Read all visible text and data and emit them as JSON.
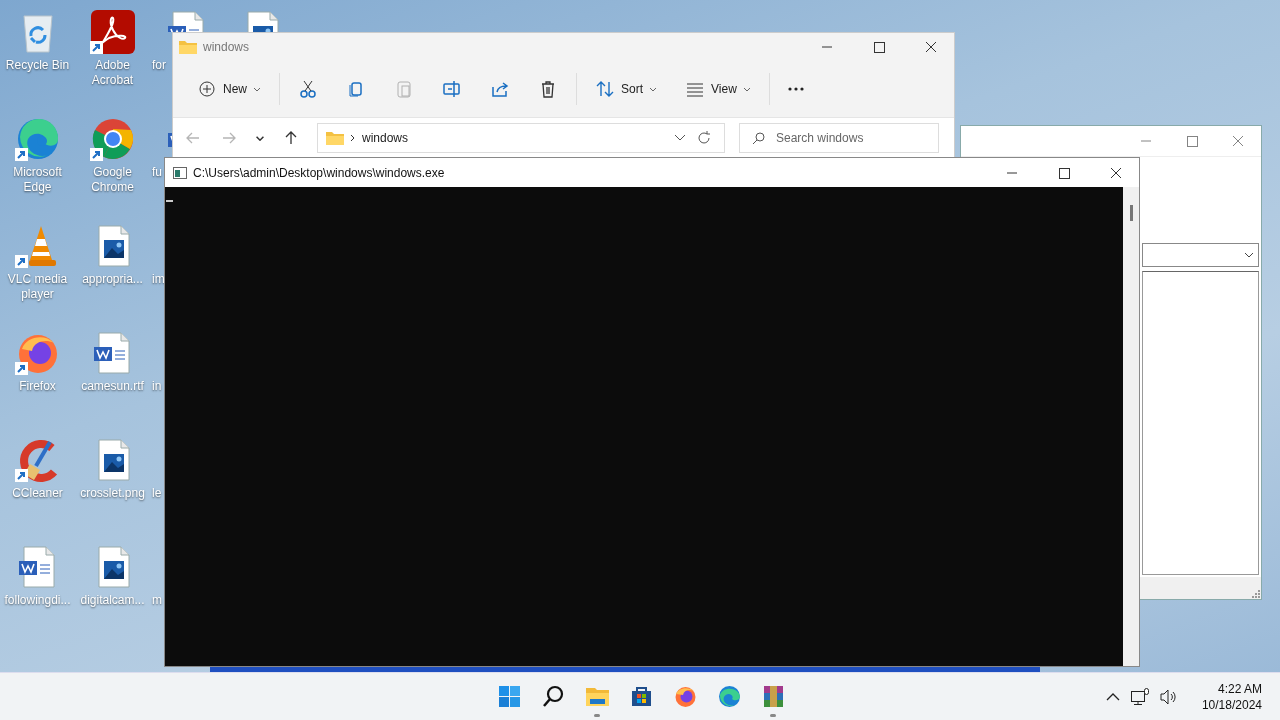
{
  "desktop_icons": [
    {
      "kind": "recycle",
      "label": "Recycle Bin"
    },
    {
      "kind": "edge",
      "label": "Microsoft Edge",
      "shortcut": true
    },
    {
      "kind": "vlc",
      "label": "VLC media player",
      "shortcut": true
    },
    {
      "kind": "firefox",
      "label": "Firefox",
      "shortcut": true
    },
    {
      "kind": "ccleaner",
      "label": "CCleaner",
      "shortcut": true
    },
    {
      "kind": "word",
      "label": "followingdi..."
    },
    {
      "kind": "acrobat",
      "label": "Adobe Acrobat",
      "shortcut": true
    },
    {
      "kind": "chrome",
      "label": "Google Chrome",
      "shortcut": true
    },
    {
      "kind": "image",
      "label": "appropria..."
    },
    {
      "kind": "word",
      "label": "camesun.rtf"
    },
    {
      "kind": "image",
      "label": "crosslet.png"
    },
    {
      "kind": "image",
      "label": "digitalcam..."
    },
    {
      "kind": "word",
      "label": "for"
    },
    {
      "kind": "word",
      "label": "fu"
    },
    {
      "kind": "none",
      "label": "im"
    },
    {
      "kind": "none",
      "label": "in"
    },
    {
      "kind": "none",
      "label": "le"
    },
    {
      "kind": "none",
      "label": "m"
    },
    {
      "kind": "image"
    }
  ],
  "explorer": {
    "title": "windows",
    "toolbar": [
      {
        "kind": "new",
        "label": "New",
        "disabled": false
      },
      {
        "kind": "cut",
        "disabled": false
      },
      {
        "kind": "copy",
        "disabled": false
      },
      {
        "kind": "paste",
        "disabled": true
      },
      {
        "kind": "rename",
        "disabled": false
      },
      {
        "kind": "share",
        "disabled": false
      },
      {
        "kind": "delete",
        "disabled": false
      },
      {
        "kind": "sort",
        "label": "Sort",
        "disabled": false
      },
      {
        "kind": "view",
        "label": "View",
        "disabled": false
      },
      {
        "kind": "more",
        "disabled": false
      }
    ],
    "nav": [
      {
        "kind": "back",
        "disabled": true
      },
      {
        "kind": "forward",
        "disabled": true
      },
      {
        "kind": "recent",
        "disabled": false
      },
      {
        "kind": "up",
        "disabled": false
      }
    ],
    "breadcrumb": "windows",
    "search": {
      "placeholder": "Search windows"
    }
  },
  "console": {
    "title": "C:\\Users\\admin\\Desktop\\windows\\windows.exe"
  },
  "taskbar": {
    "apps": [
      {
        "kind": "start",
        "running": false
      },
      {
        "kind": "search",
        "running": false
      },
      {
        "kind": "explorer",
        "running": true
      },
      {
        "kind": "store",
        "running": false
      },
      {
        "kind": "firefox",
        "running": false
      },
      {
        "kind": "edge",
        "running": false
      },
      {
        "kind": "winrar",
        "running": true
      }
    ],
    "time": "4:22 AM",
    "date": "10/18/2024"
  }
}
